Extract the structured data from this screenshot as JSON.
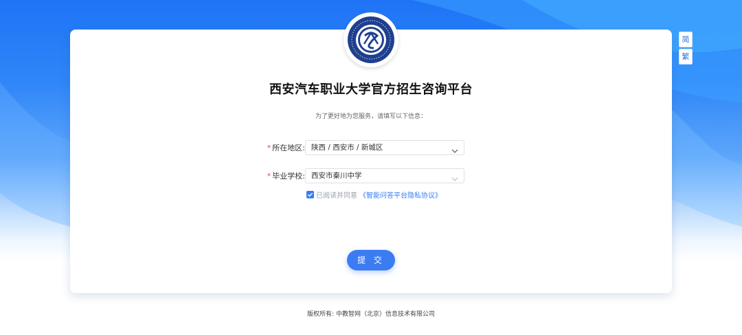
{
  "page": {
    "title": "西安汽车职业大学官方招生咨询平台",
    "subtitle": "为了更好地为您服务，请填写以下信息："
  },
  "lang_switch": {
    "simplified": "简",
    "traditional": "繁"
  },
  "logo": {
    "icon": "university-emblem-icon"
  },
  "form": {
    "region": {
      "required_mark": "*",
      "label": "所在地区:",
      "value": "陕西 / 西安市 / 新城区"
    },
    "school": {
      "required_mark": "*",
      "label": "毕业学校:",
      "value": "西安市秦川中学"
    },
    "agreement": {
      "checked": true,
      "text": "已阅读并同意",
      "link": "《智能问答平台隐私协议》"
    },
    "submit_label": "提 交"
  },
  "footer": {
    "copyright": "版权所有: 中教智网（北京）信息技术有限公司"
  },
  "colors": {
    "primary": "#3b7cf3",
    "background_top": "#1e74f5",
    "required": "#e84a4a",
    "logo_blue": "#1f3f8f"
  }
}
